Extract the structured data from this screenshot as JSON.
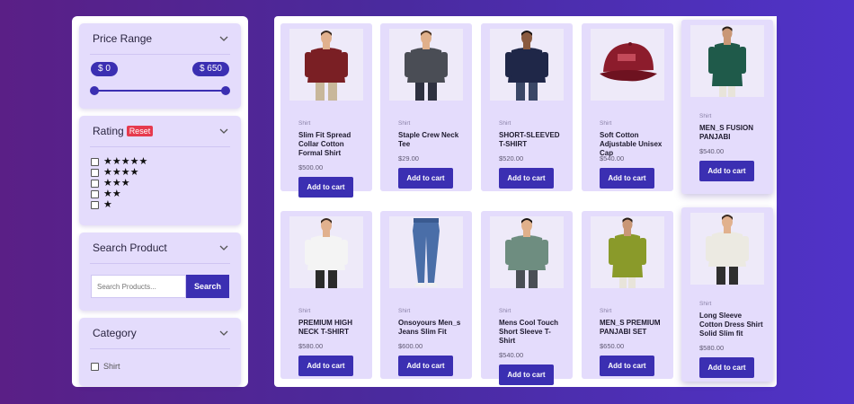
{
  "filters": {
    "price": {
      "title": "Price Range",
      "min_label": "$ 0",
      "max_label": "$ 650",
      "min_fraction": 0.0,
      "max_fraction": 1.0
    },
    "rating": {
      "title": "Rating",
      "reset_label": "Reset",
      "options": [
        "★★★★★",
        "★★★★",
        "★★★",
        "★★",
        "★"
      ]
    },
    "search": {
      "title": "Search Product",
      "placeholder": "Search Products...",
      "button_label": "Search"
    },
    "category": {
      "title": "Category",
      "options": [
        "Shirt"
      ]
    }
  },
  "products": [
    {
      "category": "Shirt",
      "name": "Slim Fit Spread Collar Cotton Formal Shirt",
      "price": "$500.00",
      "button": "Add to cart",
      "image": "maroon-shirt-man"
    },
    {
      "category": "Shirt",
      "name": "Staple Crew Neck Tee",
      "price": "$29.00",
      "button": "Add to cart",
      "image": "grey-tee-man"
    },
    {
      "category": "Shirt",
      "name": "SHORT-SLEEVED T-SHIRT",
      "price": "$520.00",
      "button": "Add to cart",
      "image": "navy-tee-man"
    },
    {
      "category": "Shirt",
      "name": "Soft Cotton Adjustable Unisex Cap",
      "price": "$540.00",
      "button": "Add to cart",
      "image": "red-cap"
    },
    {
      "category": "Shirt",
      "name": "MEN_S FUSION PANJABI",
      "price": "$540.00",
      "button": "Add to cart",
      "image": "green-panjabi-man"
    },
    {
      "category": "Shirt",
      "name": "PREMIUM HIGH NECK T-SHIRT",
      "price": "$580.00",
      "button": "Add to cart",
      "image": "white-tee-man"
    },
    {
      "category": "Shirt",
      "name": "Onsoyours Men_s Jeans Slim Fit",
      "price": "$600.00",
      "button": "Add to cart",
      "image": "blue-jeans"
    },
    {
      "category": "Shirt",
      "name": "Mens Cool Touch Short Sleeve T-Shirt",
      "price": "$540.00",
      "button": "Add to cart",
      "image": "sage-tee-man"
    },
    {
      "category": "Shirt",
      "name": "MEN_S PREMIUM PANJABI SET",
      "price": "$650.00",
      "button": "Add to cart",
      "image": "olive-panjabi-man"
    },
    {
      "category": "Shirt",
      "name": "Long Sleeve Cotton Dress Shirt Solid Slim fit",
      "price": "$580.00",
      "button": "Add to cart",
      "image": "white-shirt-man"
    }
  ],
  "colors": {
    "accent": "#3b2fb2",
    "panel": "#e4dcfc",
    "badge": "#e63a4e"
  }
}
